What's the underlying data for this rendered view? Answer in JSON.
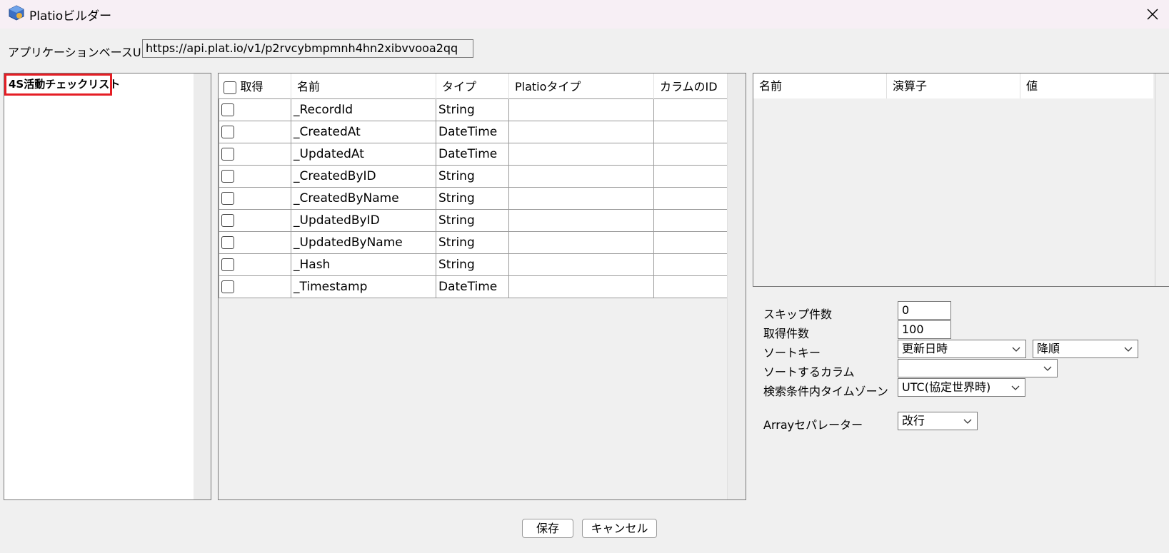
{
  "window": {
    "title": "Platioビルダー",
    "app_icon": "platio-app-icon",
    "close_icon": "close-icon"
  },
  "url": {
    "label": "アプリケーションベースURL",
    "value": "https://api.plat.io/v1/p2rvcybmpmnh4hn2xibvvooa2qq"
  },
  "tree": {
    "items": [
      "4S活動チェックリスト"
    ]
  },
  "columns_grid": {
    "headers": {
      "fetch": "取得",
      "name": "名前",
      "type": "タイプ",
      "platio_type": "Platioタイプ",
      "column_id": "カラムのID"
    },
    "rows": [
      {
        "name": "_RecordId",
        "type": "String",
        "platio_type": "",
        "column_id": ""
      },
      {
        "name": "_CreatedAt",
        "type": "DateTime",
        "platio_type": "",
        "column_id": ""
      },
      {
        "name": "_UpdatedAt",
        "type": "DateTime",
        "platio_type": "",
        "column_id": ""
      },
      {
        "name": "_CreatedByID",
        "type": "String",
        "platio_type": "",
        "column_id": ""
      },
      {
        "name": "_CreatedByName",
        "type": "String",
        "platio_type": "",
        "column_id": ""
      },
      {
        "name": "_UpdatedByID",
        "type": "String",
        "platio_type": "",
        "column_id": ""
      },
      {
        "name": "_UpdatedByName",
        "type": "String",
        "platio_type": "",
        "column_id": ""
      },
      {
        "name": "_Hash",
        "type": "String",
        "platio_type": "",
        "column_id": ""
      },
      {
        "name": "_Timestamp",
        "type": "DateTime",
        "platio_type": "",
        "column_id": ""
      }
    ]
  },
  "conditions": {
    "headers": {
      "name": "名前",
      "operator": "演算子",
      "value": "値"
    }
  },
  "options": {
    "skip_label": "スキップ件数",
    "skip_value": "0",
    "limit_label": "取得件数",
    "limit_value": "100",
    "sort_key_label": "ソートキー",
    "sort_key_value": "更新日時",
    "sort_order_value": "降順",
    "sort_column_label": "ソートするカラム",
    "sort_column_value": "",
    "timezone_label": "検索条件内タイムゾーン",
    "timezone_value": "UTC(協定世界時)",
    "array_sep_label": "Arrayセパレーター",
    "array_sep_value": "改行"
  },
  "buttons": {
    "save": "保存",
    "cancel": "キャンセル"
  }
}
